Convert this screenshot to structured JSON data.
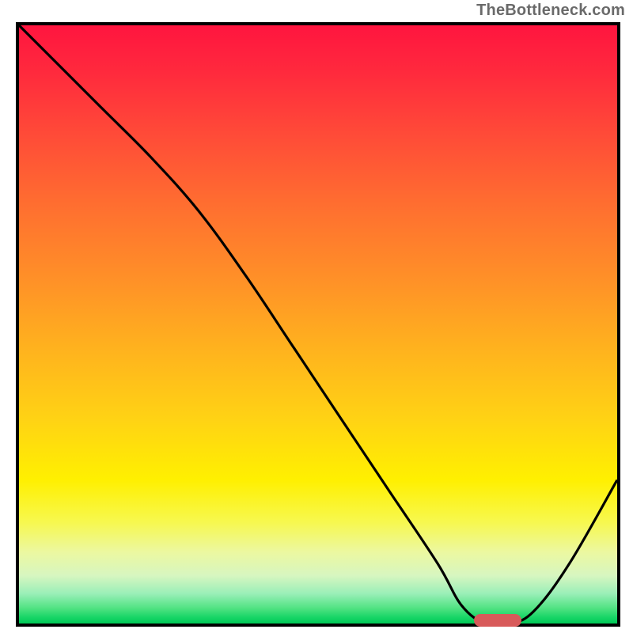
{
  "watermark": "TheBottleneck.com",
  "colors": {
    "frame_border": "#000000",
    "curve_stroke": "#000000",
    "marker_fill": "#d85a5a",
    "gradient_top": "#ff153f",
    "gradient_bottom": "#00c957",
    "watermark_text": "#6a6a6a"
  },
  "chart_data": {
    "type": "line",
    "title": "",
    "xlabel": "",
    "ylabel": "",
    "xlim": [
      0,
      100
    ],
    "ylim": [
      0,
      100
    ],
    "grid": false,
    "legend": false,
    "annotations": [],
    "series": [
      {
        "name": "curve",
        "x": [
          0,
          6,
          14,
          22,
          30,
          38,
          46,
          54,
          62,
          70,
          74,
          78,
          82,
          86,
          92,
          100
        ],
        "values": [
          100,
          94,
          86,
          78,
          69,
          58,
          46,
          34,
          22,
          10,
          3,
          0,
          0,
          2,
          10,
          24
        ]
      }
    ],
    "marker": {
      "x_center": 80,
      "y": 0,
      "width_pct": 8
    },
    "background_gradient": {
      "direction": "top-to-bottom",
      "meaning": "red=high bottleneck, green=low bottleneck",
      "stops": [
        {
          "pos": 0.0,
          "color": "#ff153f"
        },
        {
          "pos": 0.5,
          "color": "#ffb21e"
        },
        {
          "pos": 0.76,
          "color": "#fff000"
        },
        {
          "pos": 1.0,
          "color": "#00c957"
        }
      ]
    }
  }
}
